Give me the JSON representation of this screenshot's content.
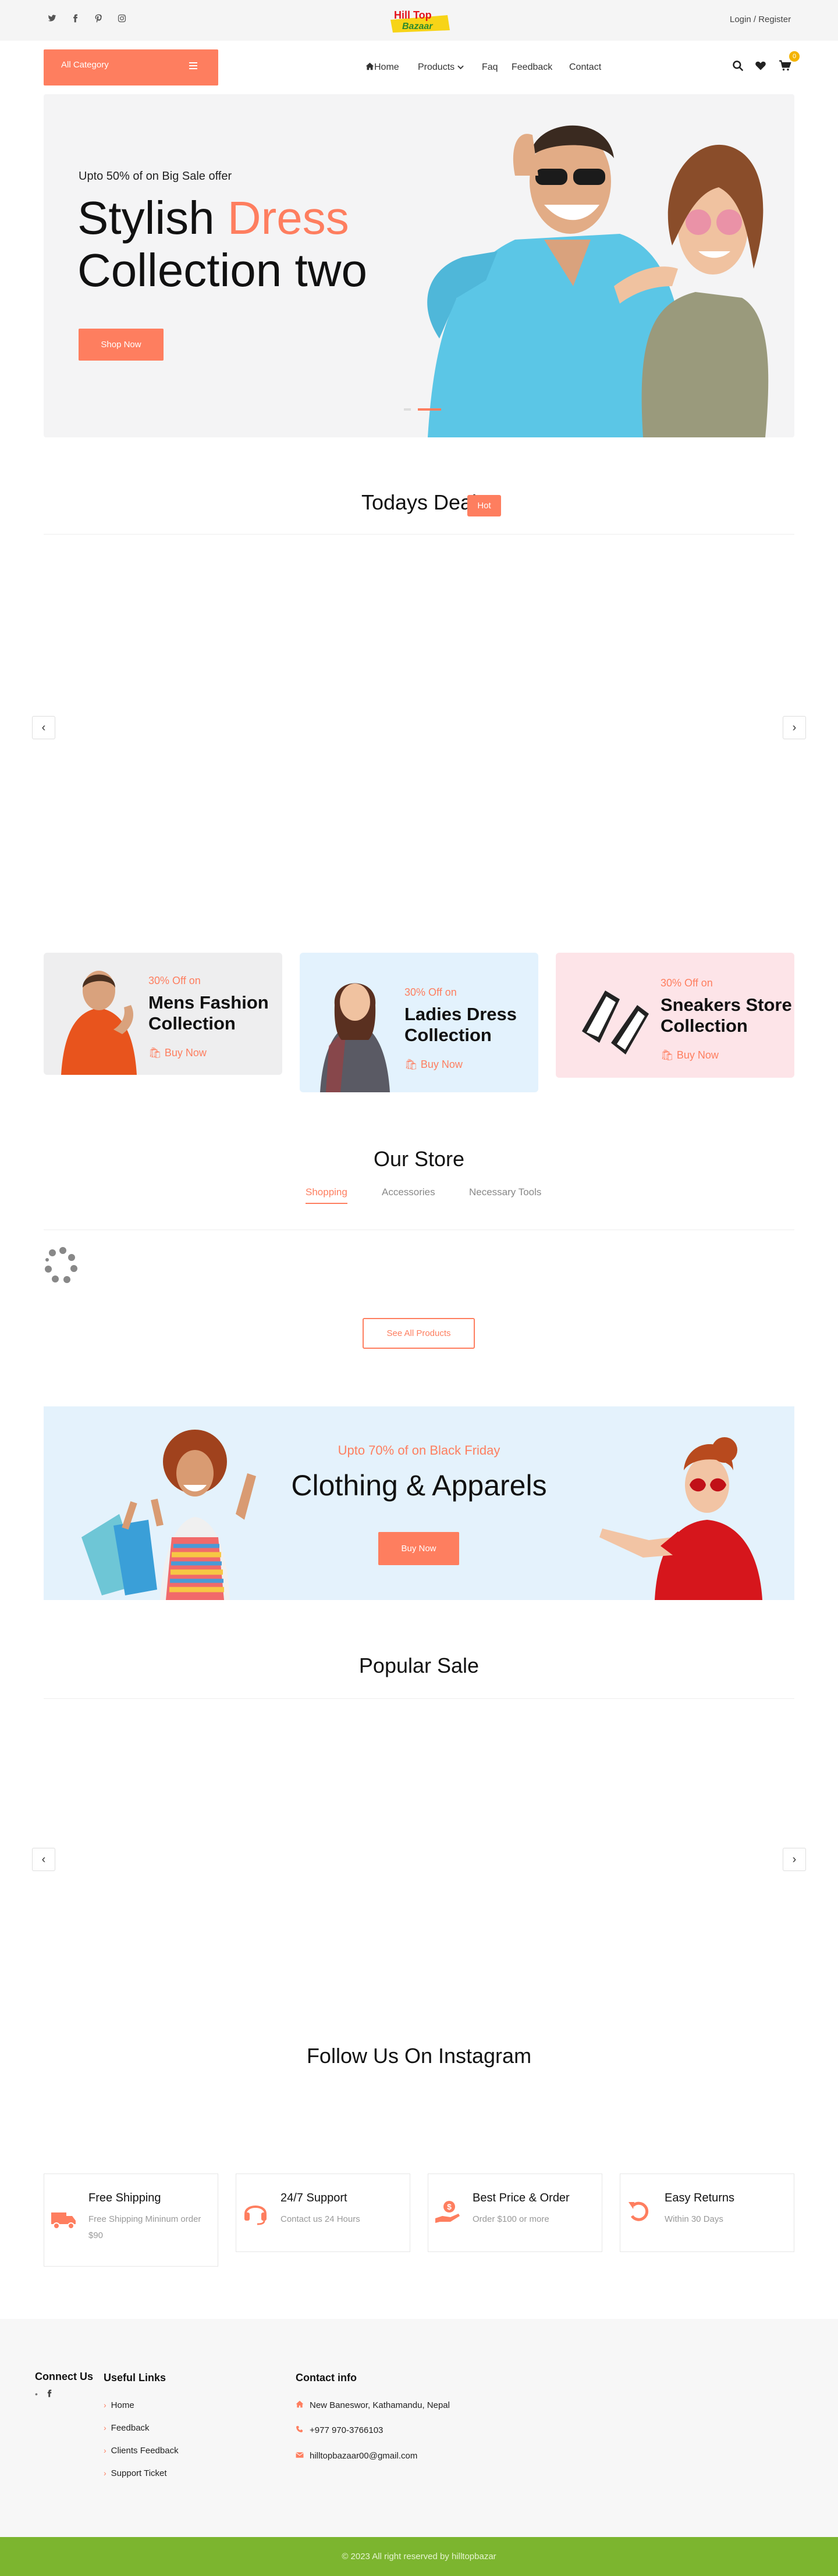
{
  "colors": {
    "accent": "#fe7e5f",
    "footer_bar": "#7cb52f",
    "badge": "#f4b400"
  },
  "topbar": {
    "social": [
      "twitter-icon",
      "facebook-icon",
      "pinterest-icon",
      "instagram-icon"
    ],
    "logo_line1": "Hill Top",
    "logo_line2": "Bazaar",
    "login": "Login / Register"
  },
  "nav": {
    "all_category": "All Category",
    "items": [
      "Home",
      "Products",
      "Faq",
      "Feedback",
      "Contact"
    ],
    "cart_count": "0"
  },
  "hero": {
    "offer": "Upto 50% of on Big Sale offer",
    "title_word1": "Stylish",
    "title_accent": "Dress",
    "title_line2": "Collection two",
    "button": "Shop Now"
  },
  "todays_deal": {
    "title": "Todays Deal",
    "badge": "Hot"
  },
  "categories": [
    {
      "off": "30% Off on",
      "title_l1": "Mens Fashion",
      "title_l2": "Collection",
      "buy": "Buy Now"
    },
    {
      "off": "30% Off on",
      "title_l1": "Ladies Dress",
      "title_l2": "Collection",
      "buy": "Buy Now"
    },
    {
      "off": "30% Off on",
      "title_l1": "Sneakers Store",
      "title_l2": "Collection",
      "buy": "Buy Now"
    }
  ],
  "store": {
    "title": "Our Store",
    "tabs": [
      "Shopping",
      "Accessories",
      "Necessary Tools"
    ],
    "see_all": "See All Products"
  },
  "banner": {
    "sub": "Upto 70% of on Black Friday",
    "title": "Clothing & Apparels",
    "button": "Buy Now"
  },
  "popular": {
    "title": "Popular Sale"
  },
  "instagram": {
    "title": "Follow Us On Instagram"
  },
  "features": [
    {
      "title": "Free Shipping",
      "desc": "Free Shipping Mininum order $90",
      "icon": "truck-icon"
    },
    {
      "title": "24/7 Support",
      "desc": "Contact us 24 Hours",
      "icon": "headset-icon"
    },
    {
      "title": "Best Price & Order",
      "desc": "Order $100 or more",
      "icon": "hand-dollar-icon"
    },
    {
      "title": "Easy Returns",
      "desc": "Within 30 Days",
      "icon": "return-icon"
    }
  ],
  "footer": {
    "connect": "Connect Us",
    "useful": "Useful Links",
    "links": [
      "Home",
      "Feedback",
      "Clients Feedback",
      "Support Ticket"
    ],
    "contact_head": "Contact info",
    "address": "New Baneswor, Kathamandu, Nepal",
    "phone": "+977 970-3766103",
    "email": "hilltopbazaar00@gmail.com",
    "copyright": "© 2023 All right reserved by hilltopbazar"
  }
}
